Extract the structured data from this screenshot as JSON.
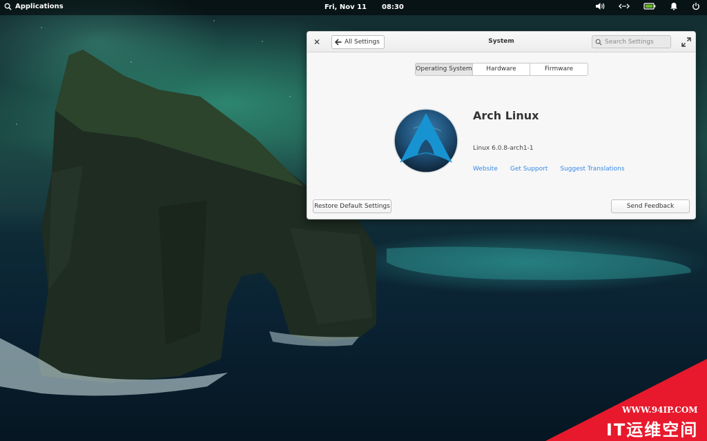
{
  "panel": {
    "applications_label": "Applications",
    "date": "Fri, Nov 11",
    "time": "08:30",
    "icons": [
      "search-icon",
      "volume-icon",
      "network-icon",
      "battery-icon",
      "notification-bell-icon",
      "power-icon"
    ]
  },
  "window": {
    "title": "System",
    "back_label": "All Settings",
    "search_placeholder": "Search Settings",
    "tabs": [
      {
        "label": "Operating System",
        "active": true
      },
      {
        "label": "Hardware",
        "active": false
      },
      {
        "label": "Firmware",
        "active": false
      }
    ],
    "os_name": "Arch Linux",
    "kernel_version": "Linux 6.0.8-arch1-1",
    "links": [
      "Website",
      "Get Support",
      "Suggest Translations"
    ],
    "restore_button": "Restore Default Settings",
    "feedback_button": "Send Feedback"
  },
  "watermark": {
    "url": "WWW.94IP.COM",
    "brand": "IT运维空间"
  },
  "colors": {
    "link": "#3689e6",
    "arch_blue": "#1793d1",
    "watermark_red": "#e8192c"
  }
}
